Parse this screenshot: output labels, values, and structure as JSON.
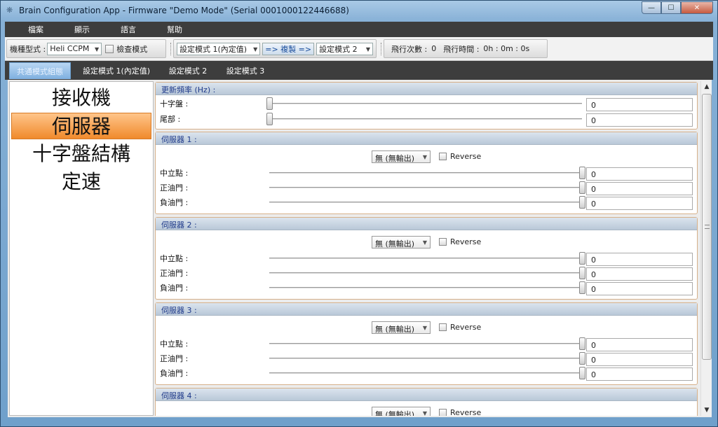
{
  "window": {
    "title": "Brain Configuration App - Firmware \"Demo Mode\" (Serial 0001000122446688)",
    "minimize": "—",
    "maximize": "☐",
    "close": "✕"
  },
  "menu": [
    "檔案",
    "顯示",
    "語言",
    "幫助"
  ],
  "toolbar": {
    "model_label": "機種型式 :",
    "model_value": "Heli CCPM",
    "check_mode_label": "檢查模式",
    "source_mode": "設定模式 1(內定值)",
    "copy_label": "=> 複製 =>",
    "target_mode": "設定模式 2",
    "flight_count_label": "飛行次數 :",
    "flight_count": "0",
    "flight_time_label": "飛行時間 :",
    "flight_time": "0h : 0m : 0s"
  },
  "tabs": [
    "共通模式組態",
    "設定模式 1(內定值)",
    "設定模式 2",
    "設定模式 3"
  ],
  "nav": [
    "接收機",
    "伺服器",
    "十字盤結構",
    "定速"
  ],
  "update_rate": {
    "title": "更新頻率 (Hz) :",
    "rows": [
      {
        "label": "十字盤 :",
        "value": "0"
      },
      {
        "label": "尾部 :",
        "value": "0"
      }
    ]
  },
  "servos": [
    {
      "title": "伺服器 1 :",
      "output": "無 (無輸出)",
      "reverse": "Reverse",
      "rows": [
        {
          "label": "中立點 :",
          "value": "0"
        },
        {
          "label": "正油門 :",
          "value": "0"
        },
        {
          "label": "負油門 :",
          "value": "0"
        }
      ]
    },
    {
      "title": "伺服器 2 :",
      "output": "無 (無輸出)",
      "reverse": "Reverse",
      "rows": [
        {
          "label": "中立點 :",
          "value": "0"
        },
        {
          "label": "正油門 :",
          "value": "0"
        },
        {
          "label": "負油門 :",
          "value": "0"
        }
      ]
    },
    {
      "title": "伺服器 3 :",
      "output": "無 (無輸出)",
      "reverse": "Reverse",
      "rows": [
        {
          "label": "中立點 :",
          "value": "0"
        },
        {
          "label": "正油門 :",
          "value": "0"
        },
        {
          "label": "負油門 :",
          "value": "0"
        }
      ]
    },
    {
      "title": "伺服器 4 :",
      "output": "無 (無輸出)",
      "reverse": "Reverse",
      "rows": []
    }
  ],
  "icons": {
    "app": "brain-icon",
    "scroll_up": "▲",
    "scroll_down": "▼"
  }
}
